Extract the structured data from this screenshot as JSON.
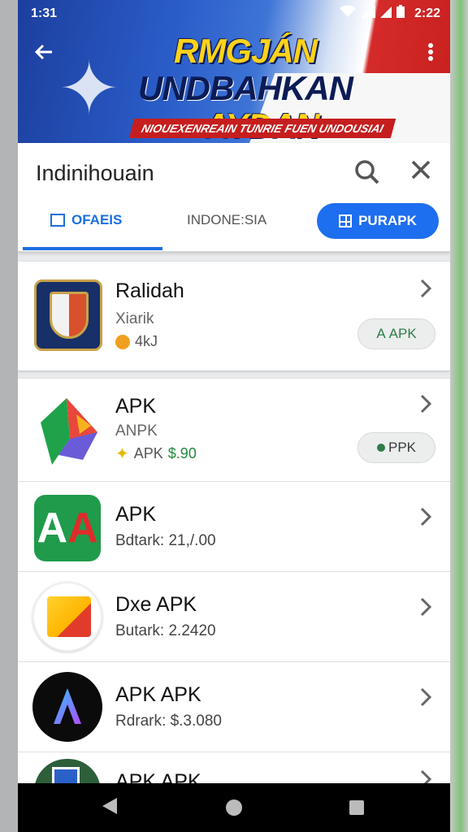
{
  "status_bar": {
    "time_left": "1:31",
    "time_right": "2:22"
  },
  "banner": {
    "title_line1_a": "RMGJÁN",
    "title_line1_b": "UNDBAHKAN",
    "title_line2": "AYDAN INDONESIA",
    "ribbon": "NIOUEXENREAIN TUNRIE FUEN UNDOUSIAI"
  },
  "search": {
    "query": "Indinihouain"
  },
  "tabs": [
    {
      "label": "OFAEIS"
    },
    {
      "label": "INDONE:SIA"
    },
    {
      "label": "PURAPK"
    }
  ],
  "apps": [
    {
      "title": "Ralidah",
      "subtitle": "Xiarik",
      "meta": "4kJ",
      "action": "APK",
      "action_prefix": "A"
    },
    {
      "title": "APK",
      "subtitle": "ANPK",
      "meta_label": "APK",
      "meta_price": "$.90",
      "action": "PPK",
      "action_prefix": "●"
    },
    {
      "title": "APK",
      "detail": "Bdtark: 21,/.00"
    },
    {
      "title": "Dxe APK",
      "detail": "Butark: 2.2420"
    },
    {
      "title": "APK APK",
      "detail": "Rdrark: $.3.080"
    },
    {
      "title": "APK APK"
    }
  ],
  "colors": {
    "accent": "#1e6ef0",
    "price_green": "#1f8a3b",
    "banner_yellow": "#ffd21a",
    "banner_red": "#c61e1e"
  }
}
